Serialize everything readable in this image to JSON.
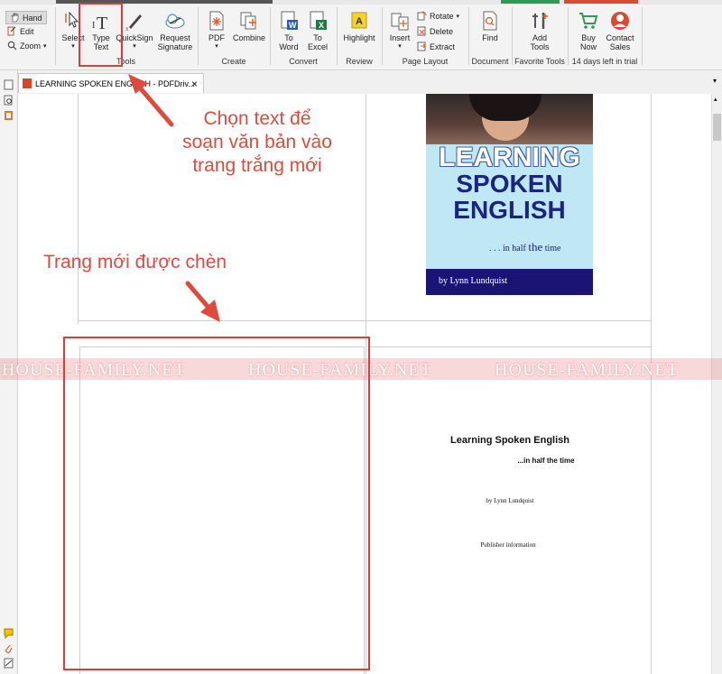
{
  "ribbon": {
    "mode_tools": [
      "Hand",
      "Edit",
      "Zoom"
    ],
    "tools_group": {
      "label": "Tools",
      "buttons": [
        {
          "label": "Select",
          "icon": "select-cursor-icon"
        },
        {
          "label": "Type\nText",
          "line1": "Type",
          "line2": "Text",
          "icon": "type-text-icon"
        },
        {
          "label": "QuickSign",
          "icon": "pen-sign-icon"
        },
        {
          "label": "Request\nSignature",
          "line1": "Request",
          "line2": "Signature",
          "icon": "cloud-signature-icon"
        }
      ]
    },
    "create_group": {
      "label": "Create",
      "buttons": [
        {
          "label": "PDF",
          "icon": "pdf-create-icon"
        },
        {
          "label": "Combine",
          "icon": "combine-icon"
        }
      ]
    },
    "convert_group": {
      "label": "Convert",
      "buttons": [
        {
          "line1": "To",
          "line2": "Word",
          "icon": "word-icon"
        },
        {
          "line1": "To",
          "line2": "Excel",
          "icon": "excel-icon"
        }
      ]
    },
    "review_group": {
      "label": "Review",
      "buttons": [
        {
          "label": "Highlight",
          "icon": "highlight-icon"
        }
      ]
    },
    "page_layout_group": {
      "label": "Page Layout",
      "insert_label": "Insert",
      "items": [
        "Rotate",
        "Delete",
        "Extract"
      ]
    },
    "document_group": {
      "label": "Document",
      "buttons": [
        {
          "label": "Find",
          "icon": "find-icon"
        }
      ]
    },
    "favorite_group": {
      "label": "Favorite Tools",
      "buttons": [
        {
          "line1": "Add",
          "line2": "Tools",
          "icon": "add-tools-icon"
        }
      ]
    },
    "trial_group": {
      "label": "14 days left in trial",
      "buttons": [
        {
          "line1": "Buy",
          "line2": "Now",
          "icon": "cart-icon"
        },
        {
          "line1": "Contact",
          "line2": "Sales",
          "icon": "contact-sales-icon"
        }
      ]
    }
  },
  "tab": {
    "title": "LEARNING SPOKEN ENGLISH - PDFDriv...",
    "close": "×"
  },
  "annotations": {
    "choose_text": [
      "Chọn text để",
      "soạn văn bản vào",
      "trang trắng mới"
    ],
    "new_page": "Trang mới được chèn"
  },
  "cover": {
    "title_line1": "LEARNING",
    "title_line2": "SPOKEN",
    "title_line3": "ENGLISH",
    "subtitle_pre": ". . . in half",
    "subtitle_the": "the",
    "subtitle_post": "time",
    "author": "by Lynn Lundquist"
  },
  "page2": {
    "title": "Learning Spoken English",
    "subtitle": "...in half the time",
    "author": "by Lynn Lundquist",
    "publisher": "Publisher information"
  },
  "watermark": "HOUSE-FAMILY.NET",
  "colors": {
    "annotation": "#e04a3d",
    "cover_blue": "#1a2580",
    "cover_bg": "#bfe7f4",
    "highlight_box": "#e03a3a"
  }
}
